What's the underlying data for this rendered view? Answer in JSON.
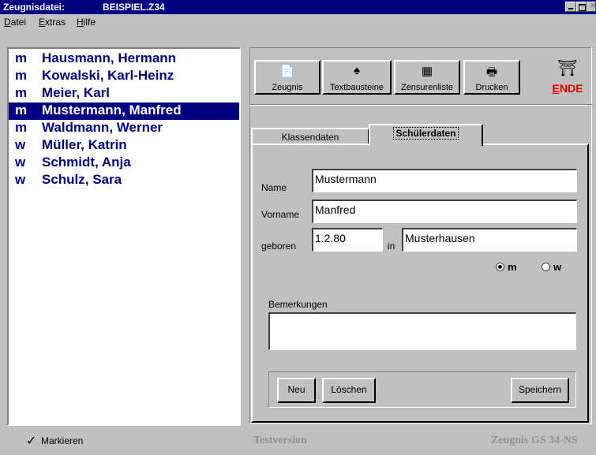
{
  "window": {
    "title_label": "Zeugnisdatei:",
    "file_name": "BEISPIEL.Z34"
  },
  "menu": [
    {
      "label": "Datei",
      "underline": "D",
      "rest": "atei"
    },
    {
      "label": "Extras",
      "underline": "E",
      "rest": "xtras"
    },
    {
      "label": "Hilfe",
      "underline": "H",
      "rest": "ilfe"
    }
  ],
  "students": [
    {
      "gender": "m",
      "name": "Hausmann, Hermann",
      "selected": false
    },
    {
      "gender": "m",
      "name": "Kowalski, Karl-Heinz",
      "selected": false
    },
    {
      "gender": "m",
      "name": "Meier, Karl",
      "selected": false
    },
    {
      "gender": "m",
      "name": "Mustermann, Manfred",
      "selected": true
    },
    {
      "gender": "m",
      "name": "Waldmann, Werner",
      "selected": false
    },
    {
      "gender": "w",
      "name": "Müller, Katrin",
      "selected": false
    },
    {
      "gender": "w",
      "name": "Schmidt, Anja",
      "selected": false
    },
    {
      "gender": "w",
      "name": "Schulz, Sara",
      "selected": false
    }
  ],
  "toolbar": {
    "zeugnis": {
      "label": "Zeugnis",
      "icon": "📄"
    },
    "textbausteine": {
      "label": "Textbausteine",
      "icon": "♠"
    },
    "zensurenliste": {
      "label": "Zensurenliste",
      "icon": "▦"
    },
    "drucken": {
      "label": "Drucken",
      "icon": "🖶"
    },
    "ende": {
      "label": "ENDE",
      "icon": "⛩",
      "color": "#e00000"
    }
  },
  "tabs": {
    "klassendaten": "Klassendaten",
    "schuelerdaten": "Schülerdaten"
  },
  "form": {
    "name_label": "Name",
    "name_value": "Mustermann",
    "vorname_label": "Vorname",
    "vorname_value": "Manfred",
    "geboren_label": "geboren",
    "geboren_value": "1.2.80",
    "in_label": "in",
    "ort_value": "Musterhausen",
    "radio_m": "m",
    "radio_w": "w",
    "selected_gender": "m",
    "bemerkungen_label": "Bemerkungen",
    "bemerkungen_value": ""
  },
  "buttons": {
    "neu": "Neu",
    "loeschen": "Löschen",
    "speichern": "Speichern"
  },
  "statusbar": {
    "markieren": "Markieren",
    "testversion": "Testversion",
    "product": "Zeugnis GS 34-NS"
  },
  "colors": {
    "title_bg": "#000080",
    "list_text": "#000080",
    "ende": "#e00000"
  }
}
